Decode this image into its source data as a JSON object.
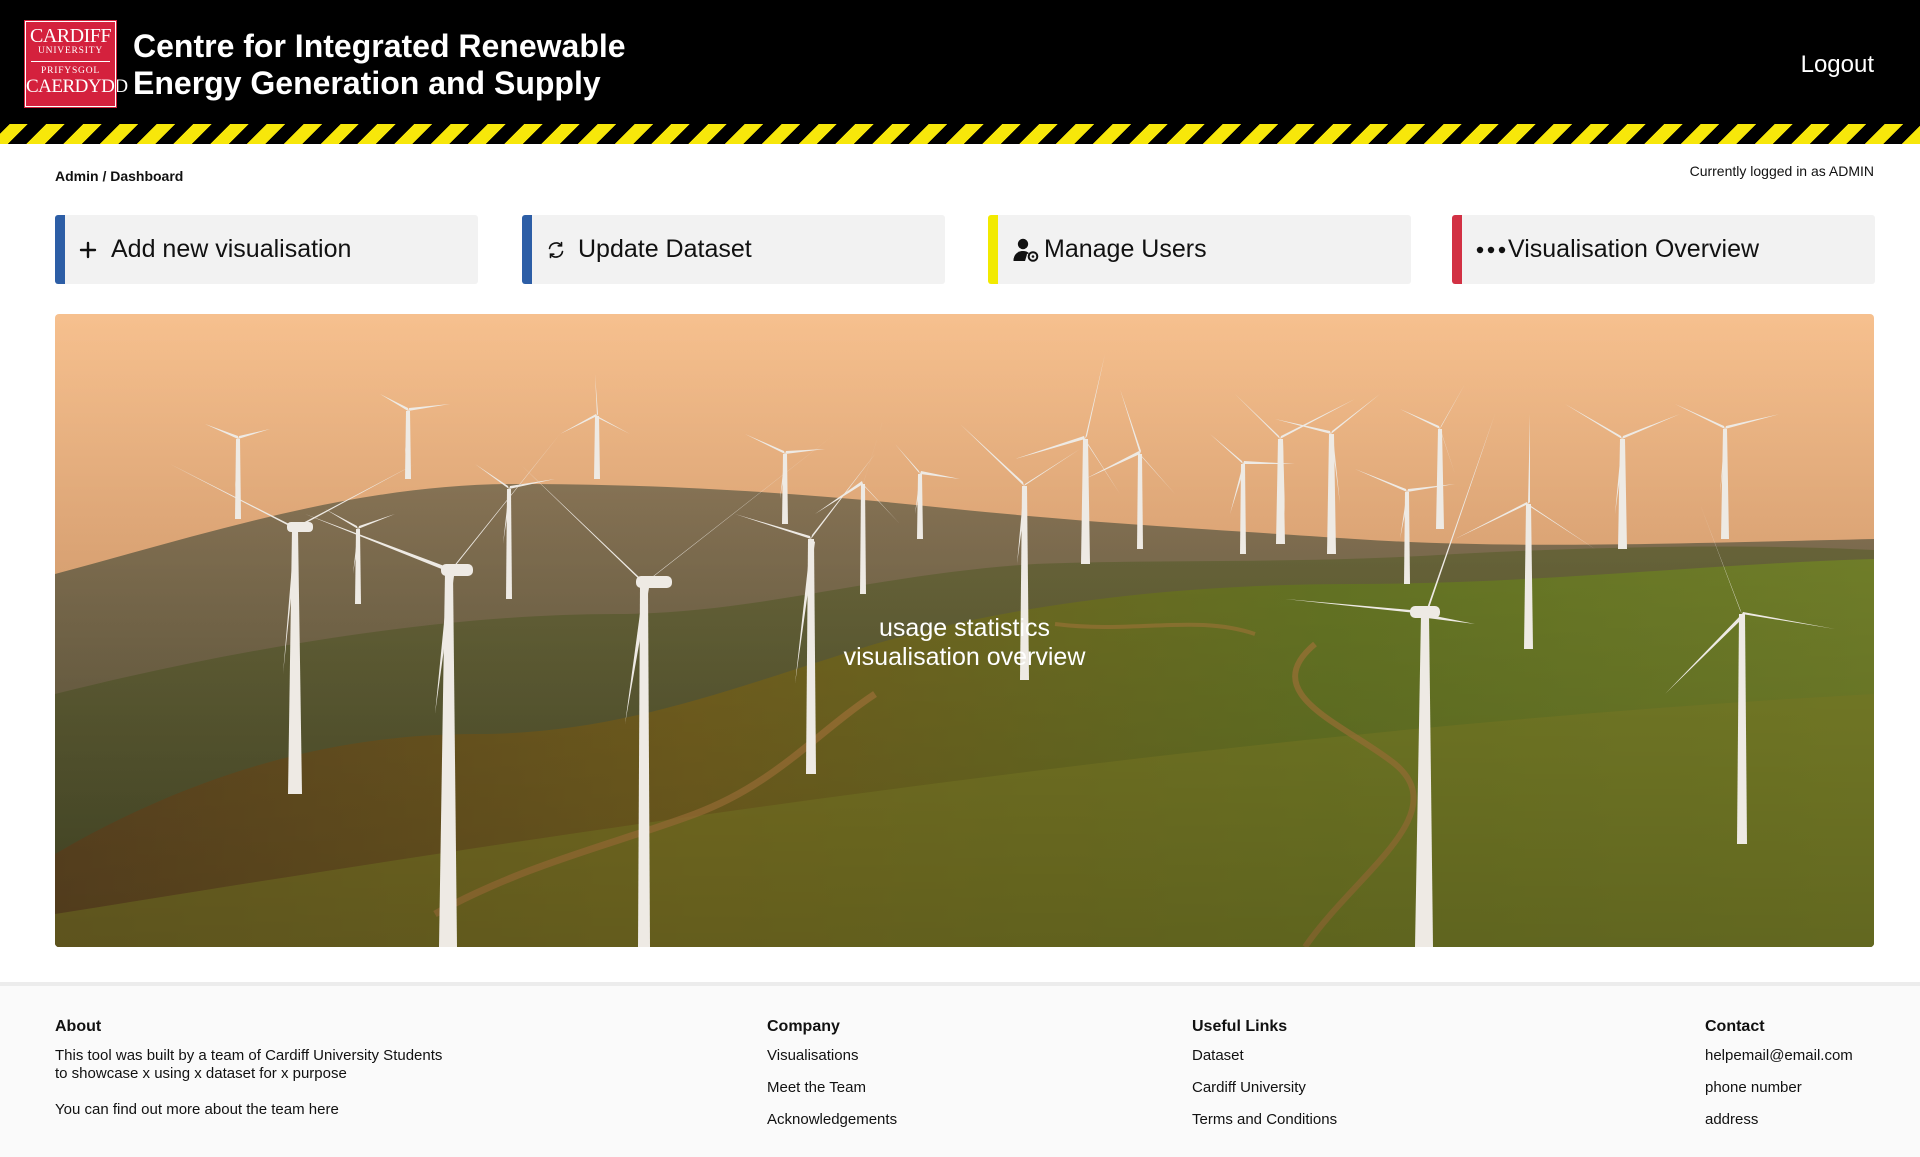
{
  "header": {
    "logo": {
      "line1": "CARDIFF",
      "line2": "UNIVERSITY",
      "line3": "PRIFYSGOL",
      "line4": "CAERDYDD"
    },
    "title_line1": "Centre for Integrated Renewable",
    "title_line2": "Energy Generation and Supply",
    "logout_label": "Logout"
  },
  "breadcrumb": "Admin / Dashboard",
  "logged_in_text": "Currently logged in as ADMIN",
  "actions": [
    {
      "label": "Add new visualisation",
      "icon": "plus-icon",
      "accent": "#2d5ea6"
    },
    {
      "label": "Update Dataset",
      "icon": "refresh-icon",
      "accent": "#2d5ea6"
    },
    {
      "label": "Manage Users",
      "icon": "user-settings-icon",
      "accent": "#f2ea00"
    },
    {
      "label": "Visualisation Overview",
      "icon": "more-dots-icon",
      "accent": "#d23144"
    }
  ],
  "hero": {
    "line1": "usage statistics",
    "line2": "visualisation overview"
  },
  "footer": {
    "about": {
      "heading": "About",
      "line1": "This tool was built by a team of Cardiff University Students",
      "line2": "to showcase x using x dataset for x purpose",
      "line3": "You can find out more about the team here"
    },
    "company": {
      "heading": "Company",
      "links": [
        "Visualisations",
        "Meet the Team",
        "Acknowledgements"
      ]
    },
    "useful_links": {
      "heading": "Useful Links",
      "links": [
        "Dataset",
        "Cardiff University",
        "Terms and Conditions"
      ]
    },
    "contact": {
      "heading": "Contact",
      "items": [
        "helpemail@email.com",
        "phone number",
        "address"
      ]
    }
  },
  "colors": {
    "header_bg": "#000000",
    "hazard_yellow": "#f7e70a",
    "brand_red": "#d4213d",
    "button_bg": "#f2f2f2"
  }
}
